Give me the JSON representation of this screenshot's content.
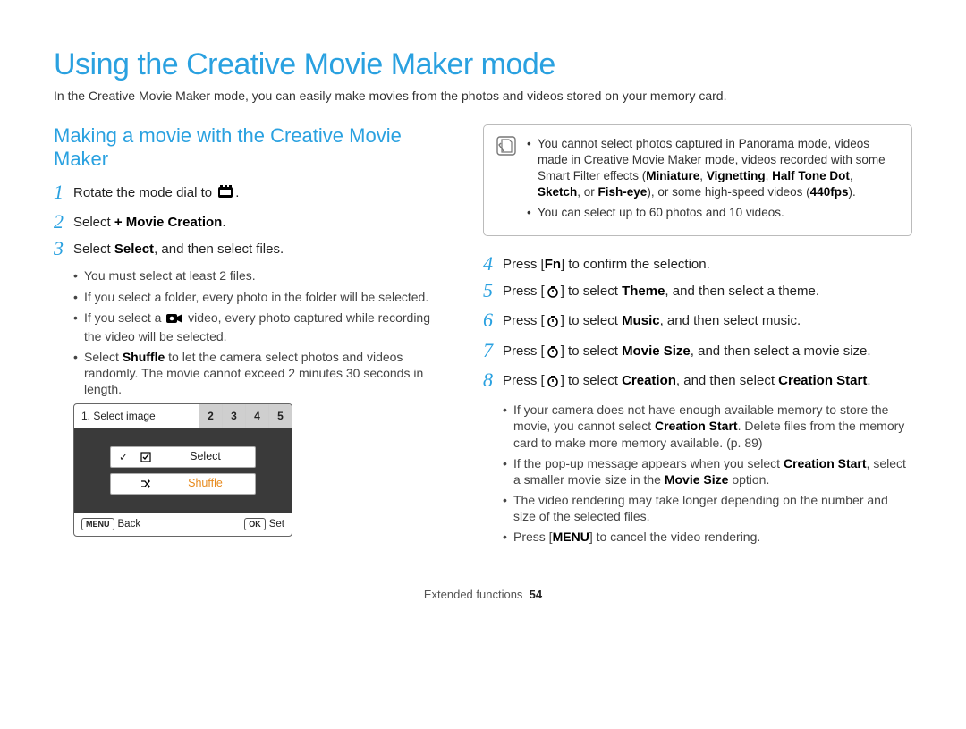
{
  "title": "Using the Creative Movie Maker mode",
  "intro": "In the Creative Movie Maker mode, you can easily make movies from the photos and videos stored on your memory card.",
  "section": "Making a movie with the Creative Movie Maker",
  "steps": {
    "s1": "Rotate the mode dial to ",
    "s1_end": ".",
    "s2_a": "Select ",
    "s2_b": "+ Movie Creation",
    "s2_c": ".",
    "s3_a": "Select ",
    "s3_b": "Select",
    "s3_c": ", and then select files.",
    "s4_a": "Press [",
    "s4_key": "Fn",
    "s4_b": "] to confirm the selection.",
    "s5_a": "Press [",
    "s5_b": "] to select ",
    "s5_c": "Theme",
    "s5_d": ", and then select a theme.",
    "s6_a": "Press [",
    "s6_b": "] to select ",
    "s6_c": "Music",
    "s6_d": ", and then select music.",
    "s7_a": "Press [",
    "s7_b": "] to select ",
    "s7_c": "Movie Size",
    "s7_d": ", and then select a movie size.",
    "s8_a": "Press [",
    "s8_b": "] to select ",
    "s8_c": "Creation",
    "s8_d": ", and then select ",
    "s8_e": "Creation Start",
    "s8_f": "."
  },
  "sub3": {
    "a": "You must select at least 2 files.",
    "b": "If you select a folder, every photo in the folder will be selected.",
    "c_a": "If you select a ",
    "c_b": " video, every photo captured while recording the video will be selected.",
    "d_a": "Select ",
    "d_b": "Shuffle",
    "d_c": " to let the camera select photos and videos randomly. The movie cannot exceed 2 minutes 30 seconds in length."
  },
  "screenshot": {
    "head": "1. Select image",
    "tabs": [
      "2",
      "3",
      "4",
      "5"
    ],
    "select": "Select",
    "shuffle": "Shuffle",
    "back": "Back",
    "set": "Set",
    "menu_chip": "MENU",
    "ok_chip": "OK"
  },
  "note": {
    "l1_a": "You cannot select photos captured in Panorama mode, videos made in Creative Movie Maker mode, videos recorded with some Smart Filter effects (",
    "l1_terms": [
      "Miniature",
      "Vignetting",
      "Half Tone Dot",
      "Sketch"
    ],
    "l1_or": ", or ",
    "l1_fe": "Fish-eye",
    "l1_b": "), or some high-speed videos (",
    "l1_fps": "440fps",
    "l1_c": ").",
    "l2": "You can select up to 60 photos and 10 videos."
  },
  "sub8": {
    "a_a": "If your camera does not have enough available memory to store the movie, you cannot select ",
    "a_b": "Creation Start",
    "a_c": ". Delete files from the memory card to make more memory available. (p. 89)",
    "b_a": "If the pop-up message appears when you select ",
    "b_b": "Creation Start",
    "b_c": ", select a smaller movie size in the ",
    "b_d": "Movie Size",
    "b_e": " option.",
    "c": "The video rendering may take longer depending on the number and size of the selected files.",
    "d_a": "Press [",
    "d_key": "MENU",
    "d_b": "] to cancel the video rendering."
  },
  "footer": {
    "label": "Extended functions",
    "page": "54"
  }
}
